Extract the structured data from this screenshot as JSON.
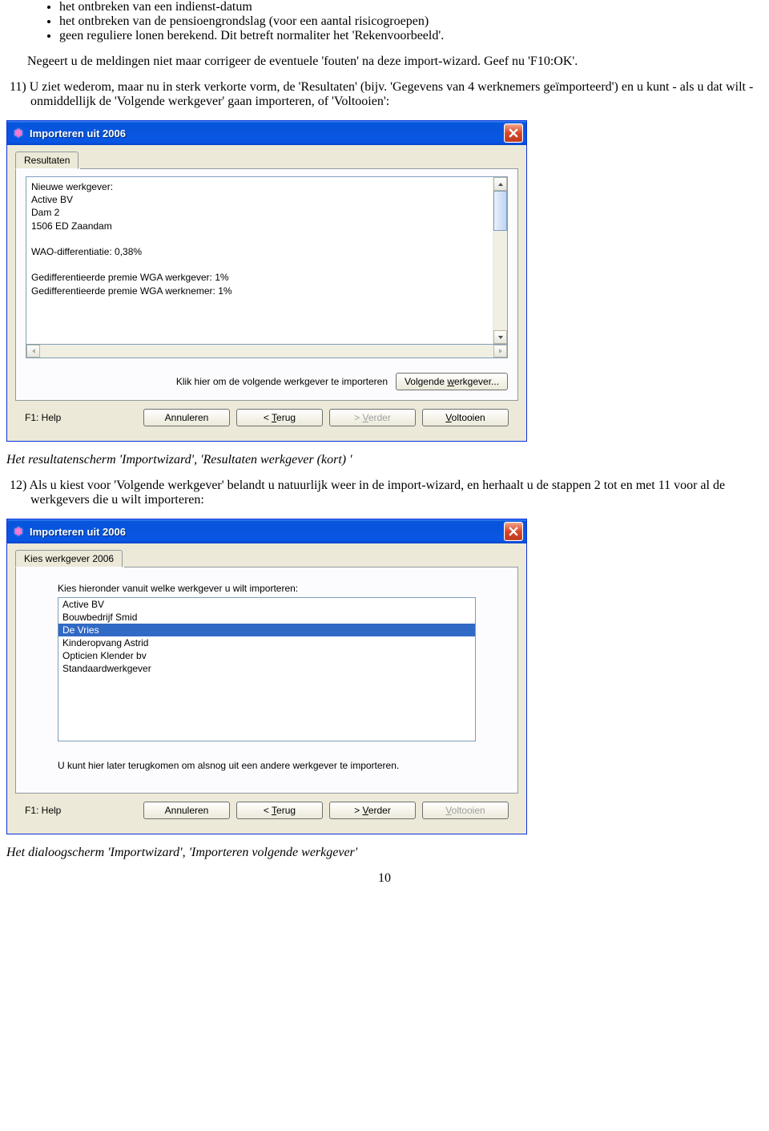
{
  "doc": {
    "bullets": [
      "het ontbreken van een indienst-datum",
      "het ontbreken van de pensioengrondslag (voor een aantal risicogroepen)",
      "geen reguliere lonen berekend. Dit betreft normaliter het 'Rekenvoorbeeld'."
    ],
    "para1": "Negeert u de meldingen niet maar corrigeer de eventuele 'fouten' na deze import-wizard. Geef nu 'F10:OK'.",
    "para2": "11) U ziet wederom, maar nu in sterk verkorte vorm, de 'Resultaten' (bijv. 'Gegevens van 4 werknemers geïmporteerd') en u kunt - als u dat wilt - onmiddellijk de 'Volgende werkgever' gaan importeren, of 'Voltooien':",
    "caption1": "Het resultatenscherm 'Importwizard',  'Resultaten werkgever (kort) '",
    "para3": "12) Als u kiest voor 'Volgende werkgever' belandt u natuurlijk weer in de import-wizard, en herhaalt u de stappen 2  tot en met 11 voor al de werkgevers die u wilt importeren:",
    "caption2": "Het dialoogscherm 'Importwizard',  'Importeren volgende werkgever'",
    "pagenum": "10"
  },
  "dlg1": {
    "title": "Importeren uit 2006",
    "tab": "Resultaten",
    "text": "Nieuwe werkgever:\nActive BV\nDam  2\n1506 ED Zaandam\n\nWAO-differentiatie: 0,38%\n\nGedifferentieerde premie WGA werkgever: 1%\nGedifferentieerde premie WGA werknemer: 1%",
    "next_label": "Klik hier om de volgende werkgever te importeren",
    "next_btn_pre": "Volgende ",
    "next_btn_hot": "w",
    "next_btn_post": "erkgever...",
    "help": "F1: Help",
    "cancel": "Annuleren",
    "back_pre": "< ",
    "back_hot": "T",
    "back_post": "erug",
    "fwd_pre": "> ",
    "fwd_hot": "V",
    "fwd_post": "erder",
    "finish_hot": "V",
    "finish_post": "oltooien"
  },
  "dlg2": {
    "title": "Importeren uit 2006",
    "tab": "Kies werkgever 2006",
    "label": "Kies hieronder vanuit welke werkgever u wilt importeren:",
    "items": [
      "Active BV",
      "Bouwbedrijf Smid",
      "De Vries",
      "Kinderopvang Astrid",
      "Opticien Klender bv",
      "Standaardwerkgever"
    ],
    "selected_index": 2,
    "note": "U kunt hier later terugkomen om alsnog uit een andere werkgever te importeren.",
    "help": "F1: Help",
    "cancel": "Annuleren",
    "back_pre": "< ",
    "back_hot": "T",
    "back_post": "erug",
    "fwd_pre": "> ",
    "fwd_hot": "V",
    "fwd_post": "erder",
    "finish_hot": "V",
    "finish_post": "oltooien"
  }
}
